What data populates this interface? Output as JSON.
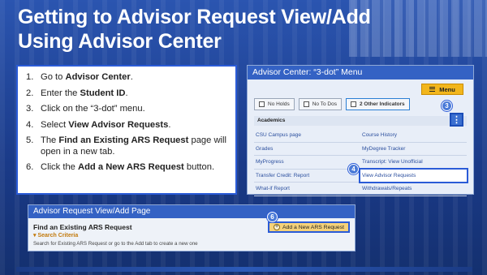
{
  "title": {
    "line1": "Getting to Advisor Request View/Add",
    "line2": "Using Advisor Center"
  },
  "steps": [
    {
      "num": "1.",
      "pre": "Go to ",
      "bold": "Advisor Center",
      "post": "."
    },
    {
      "num": "2.",
      "pre": "Enter the ",
      "bold": "Student ID",
      "post": "."
    },
    {
      "num": "3.",
      "pre": "Click on the “3-dot” menu.",
      "bold": "",
      "post": ""
    },
    {
      "num": "4.",
      "pre": "Select ",
      "bold": "View Advisor Requests",
      "post": "."
    },
    {
      "num": "5.",
      "pre": "The ",
      "bold": "Find an Existing ARS Request",
      "post": " page will open in a new tab."
    },
    {
      "num": "6.",
      "pre": "Click the ",
      "bold": "Add a New ARS Request",
      "post": " button."
    }
  ],
  "advisor_center": {
    "header": "Advisor Center: “3-dot” Menu",
    "menu_label": "Menu",
    "indicators": [
      "No Holds",
      "No To Dos",
      "2 Other Indicators"
    ],
    "section": "Academics",
    "dots_label": "⋮",
    "links": [
      [
        "CSU Campus page",
        "Course History"
      ],
      [
        "Grades",
        "MyDegree Tracker"
      ],
      [
        "MyProgress",
        "Transcript: View Unofficial"
      ],
      [
        "Transfer Credit: Report",
        "View Advisor Requests"
      ],
      [
        "What-if Report",
        "Withdrawals/Repeats"
      ]
    ]
  },
  "badges": {
    "b3": "3",
    "b4": "4",
    "b6": "6"
  },
  "request_page": {
    "header": "Advisor Request View/Add Page",
    "find_title": "Find an Existing ARS Request",
    "criteria": "Search Criteria",
    "description": "Search for Existing ARS Request or go to the Add tab to create a new one",
    "add_button": "Add a New ARS Request"
  },
  "colors": {
    "accent": "#2a5bd7",
    "header": "#3462c4",
    "menu": "#f2b61c"
  }
}
